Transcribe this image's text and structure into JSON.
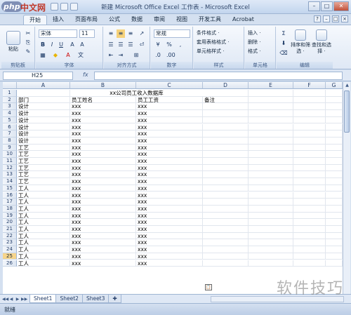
{
  "logo": {
    "mark": "php",
    "text": "中文网"
  },
  "window": {
    "title": "新建 Microsoft Office Excel 工作表 - Microsoft Excel"
  },
  "ribbon_tabs": [
    "开始",
    "插入",
    "页面布局",
    "公式",
    "数据",
    "审阅",
    "视图",
    "开发工具",
    "Acrobat"
  ],
  "ribbon": {
    "paste_label": "粘贴",
    "font_name": "宋体",
    "font_size": "11",
    "number_format": "常规",
    "styles": [
      "条件格式 ·",
      "套用表格格式 ·",
      "单元格样式 ·"
    ],
    "cells": [
      "插入 ·",
      "删除 ·",
      "格式 ·"
    ],
    "edit": [
      "排序和筛选 ·",
      "查找和选择 ·"
    ],
    "groups": [
      "剪贴板",
      "字体",
      "对齐方式",
      "数字",
      "样式",
      "单元格",
      "编辑"
    ]
  },
  "formula_bar": {
    "name_box": "H25",
    "fx": "fx"
  },
  "columns": [
    "A",
    "B",
    "C",
    "D",
    "E",
    "F",
    "G"
  ],
  "title_row": "xx公司员工收入数据库",
  "headers": [
    "部门",
    "员工姓名",
    "员工工资",
    "备注"
  ],
  "rows": [
    [
      "设计",
      "xxx",
      "xxx"
    ],
    [
      "设计",
      "xxx",
      "xxx"
    ],
    [
      "设计",
      "xxx",
      "xxx"
    ],
    [
      "设计",
      "xxx",
      "xxx"
    ],
    [
      "设计",
      "xxx",
      "xxx"
    ],
    [
      "设计",
      "xxx",
      "xxx"
    ],
    [
      "工艺",
      "xxx",
      "xxx"
    ],
    [
      "工艺",
      "xxx",
      "xxx"
    ],
    [
      "工艺",
      "xxx",
      "xxx"
    ],
    [
      "工艺",
      "xxx",
      "xxx"
    ],
    [
      "工艺",
      "xxx",
      "xxx"
    ],
    [
      "工艺",
      "xxx",
      "xxx"
    ],
    [
      "工人",
      "xxx",
      "xxx"
    ],
    [
      "工人",
      "xxx",
      "xxx"
    ],
    [
      "工人",
      "xxx",
      "xxx"
    ],
    [
      "工人",
      "xxx",
      "xxx"
    ],
    [
      "工人",
      "xxx",
      "xxx"
    ],
    [
      "工人",
      "xxx",
      "xxx"
    ],
    [
      "工人",
      "xxx",
      "xxx"
    ],
    [
      "工人",
      "xxx",
      "xxx"
    ],
    [
      "工人",
      "xxx",
      "xxx"
    ],
    [
      "工人",
      "xxx",
      "xxx"
    ],
    [
      "工人",
      "xxx",
      "xxx"
    ],
    [
      "工人",
      "xxx",
      "xxx"
    ]
  ],
  "row_numbers": [
    "1",
    "2",
    "3",
    "4",
    "5",
    "6",
    "7",
    "8",
    "9",
    "10",
    "11",
    "12",
    "13",
    "14",
    "15",
    "16",
    "17",
    "18",
    "19",
    "20",
    "21",
    "22",
    "23",
    "24",
    "25",
    "26"
  ],
  "selected_row": "25",
  "sheet_tabs": [
    "Sheet1",
    "Sheet2",
    "Sheet3"
  ],
  "status": "就绪",
  "watermark": "软件技巧"
}
